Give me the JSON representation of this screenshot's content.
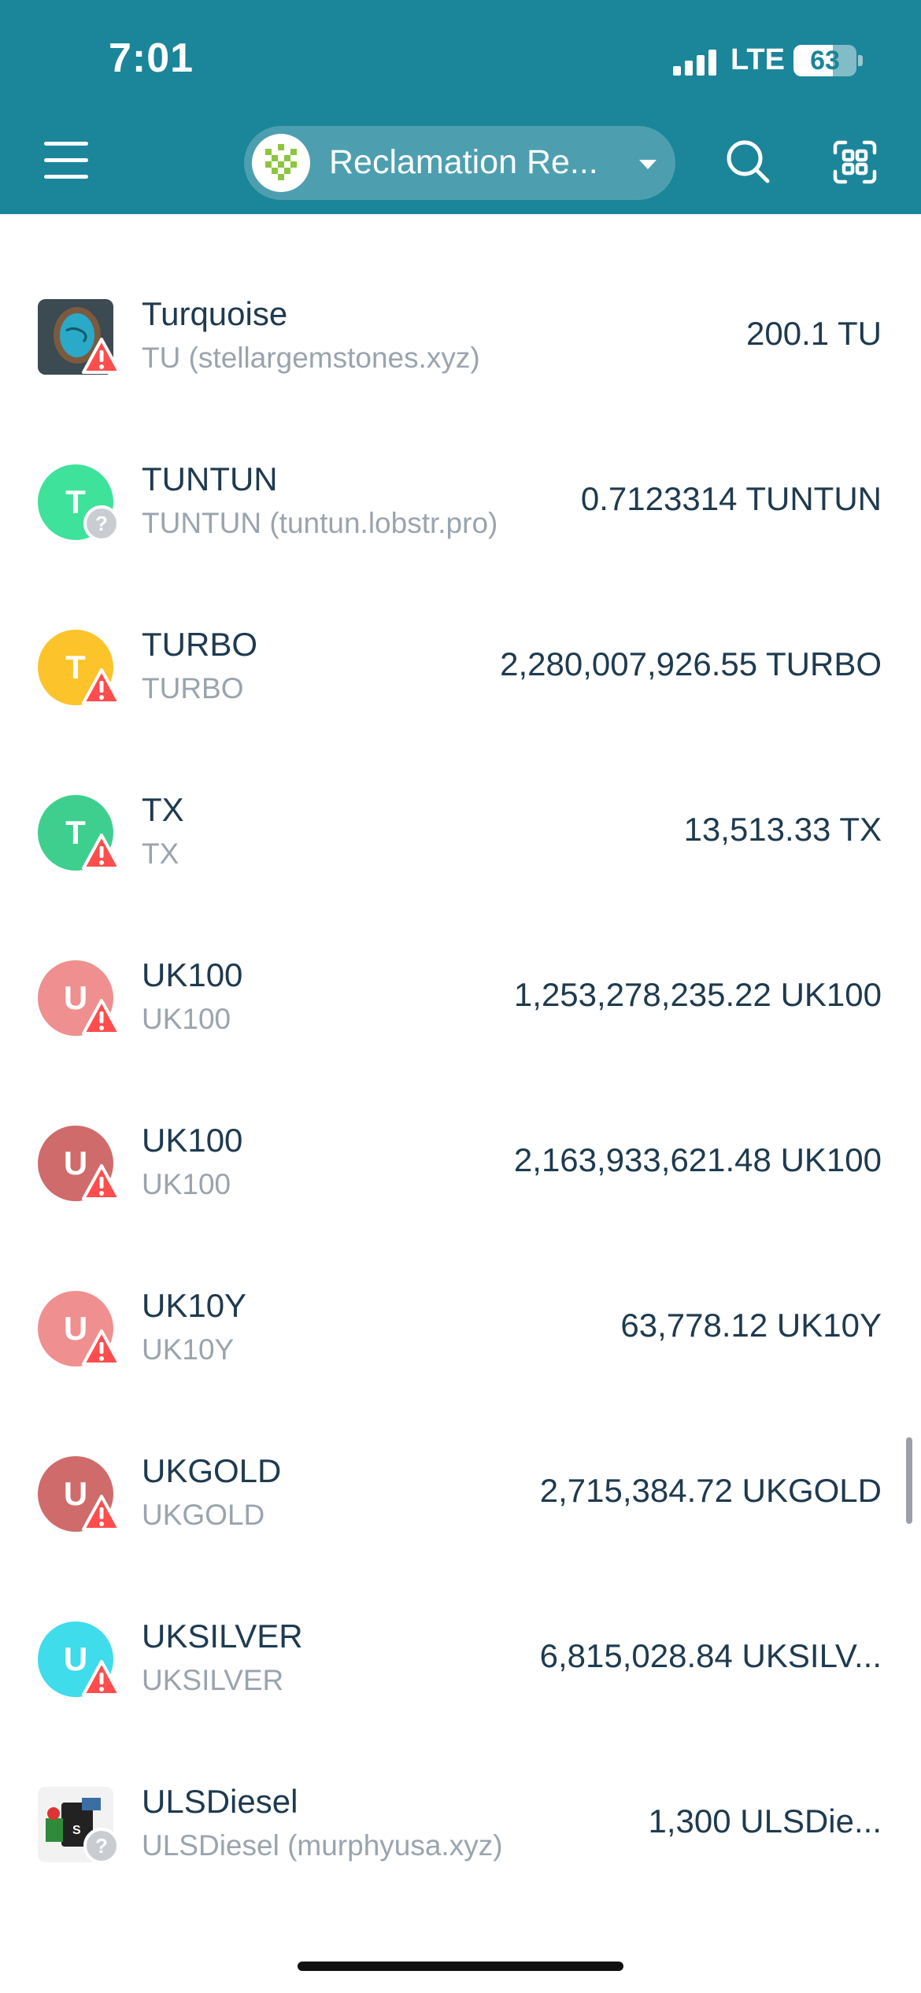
{
  "status_bar": {
    "time": "7:01",
    "network": "LTE",
    "battery": "63",
    "battery_level_percent": 63
  },
  "header": {
    "menu_icon": "hamburger-icon",
    "account_name": "Reclamation Re...",
    "search_icon": "search-icon",
    "scan_icon": "qr-scan-icon"
  },
  "assets": [
    {
      "name": "Turquoise",
      "sub": "TU (stellargemstones.xyz)",
      "balance": "200.1 TU",
      "avatar": "image",
      "avatar_letter": "",
      "color": "#2f6f86",
      "badge": "warning"
    },
    {
      "name": "TUNTUN",
      "sub": "TUNTUN (tuntun.lobstr.pro)",
      "balance": "0.7123314 TUNTUN",
      "avatar": "letter",
      "avatar_letter": "T",
      "color": "#3ee29a",
      "badge": "unknown"
    },
    {
      "name": "TURBO",
      "sub": "TURBO",
      "balance": "2,280,007,926.55 TURBO",
      "avatar": "letter",
      "avatar_letter": "T",
      "color": "#fcc42a",
      "badge": "warning"
    },
    {
      "name": "TX",
      "sub": "TX",
      "balance": "13,513.33 TX",
      "avatar": "letter",
      "avatar_letter": "T",
      "color": "#3ecf8e",
      "badge": "warning"
    },
    {
      "name": "UK100",
      "sub": "UK100",
      "balance": "1,253,278,235.22 UK100",
      "avatar": "letter",
      "avatar_letter": "U",
      "color": "#ef8f8f",
      "badge": "warning"
    },
    {
      "name": "UK100",
      "sub": "UK100",
      "balance": "2,163,933,621.48 UK100",
      "avatar": "letter",
      "avatar_letter": "U",
      "color": "#d06b6b",
      "badge": "warning"
    },
    {
      "name": "UK10Y",
      "sub": "UK10Y",
      "balance": "63,778.12 UK10Y",
      "avatar": "letter",
      "avatar_letter": "U",
      "color": "#ef8f8f",
      "badge": "warning"
    },
    {
      "name": "UKGOLD",
      "sub": "UKGOLD",
      "balance": "2,715,384.72 UKGOLD",
      "avatar": "letter",
      "avatar_letter": "U",
      "color": "#d06b6b",
      "badge": "warning"
    },
    {
      "name": "UKSILVER",
      "sub": "UKSILVER",
      "balance": "6,815,028.84 UKSILV...",
      "avatar": "letter",
      "avatar_letter": "U",
      "color": "#3fdcec",
      "badge": "warning"
    },
    {
      "name": "ULSDiesel",
      "sub": "ULSDiesel (murphyusa.xyz)",
      "balance": "1,300 ULSDie...",
      "avatar": "image",
      "avatar_letter": "",
      "color": "#e6e6e6",
      "badge": "unknown"
    }
  ]
}
